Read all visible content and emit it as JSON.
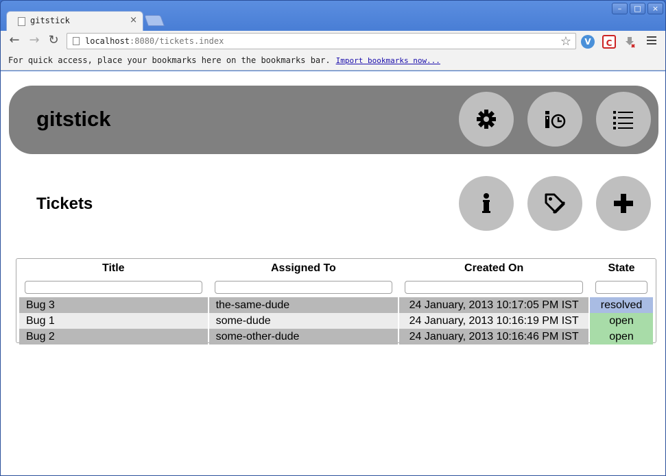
{
  "browser": {
    "tab_title": "gitstick",
    "tab_close": "×",
    "url_host": "localhost",
    "url_rest": ":8080/tickets.index",
    "star": "☆",
    "bookmarks_text": "For quick access, place your bookmarks here on the bookmarks bar.",
    "bookmarks_link": "Import bookmarks now...",
    "nav": {
      "back": "←",
      "forward": "→",
      "reload": "↻"
    },
    "window_controls": {
      "minimize": "–",
      "maximize": "□",
      "close": "×"
    },
    "extensions": [
      {
        "icon": "v-extension-icon",
        "label": "V",
        "color": "#4a90d9"
      },
      {
        "icon": "c-extension-icon",
        "label": "C",
        "color": "#cc2222"
      }
    ]
  },
  "app": {
    "brand": "gitstick",
    "header_buttons": [
      {
        "icon": "gear-icon",
        "name": "settings-button"
      },
      {
        "icon": "history-icon",
        "name": "history-button"
      },
      {
        "icon": "list-icon",
        "name": "list-button"
      }
    ],
    "section_title": "Tickets",
    "section_buttons": [
      {
        "icon": "info-icon",
        "name": "info-button"
      },
      {
        "icon": "tag-icon",
        "name": "tag-button"
      },
      {
        "icon": "plus-icon",
        "name": "add-ticket-button"
      }
    ]
  },
  "table": {
    "columns": [
      "Title",
      "Assigned To",
      "Created On",
      "State"
    ],
    "rows": [
      {
        "title": "Bug 3",
        "assigned": "the-same-dude",
        "created": "24 January, 2013 10:17:05 PM IST",
        "state": "resolved"
      },
      {
        "title": "Bug 1",
        "assigned": "some-dude",
        "created": "24 January, 2013 10:16:19 PM IST",
        "state": "open"
      },
      {
        "title": "Bug 2",
        "assigned": "some-other-dude",
        "created": "24 January, 2013 10:16:46 PM IST",
        "state": "open"
      }
    ]
  },
  "colors": {
    "header_bg": "#808080",
    "button_bg": "#bfbfbf",
    "state_resolved": "#a9bce3",
    "state_open": "#a8dca8"
  }
}
